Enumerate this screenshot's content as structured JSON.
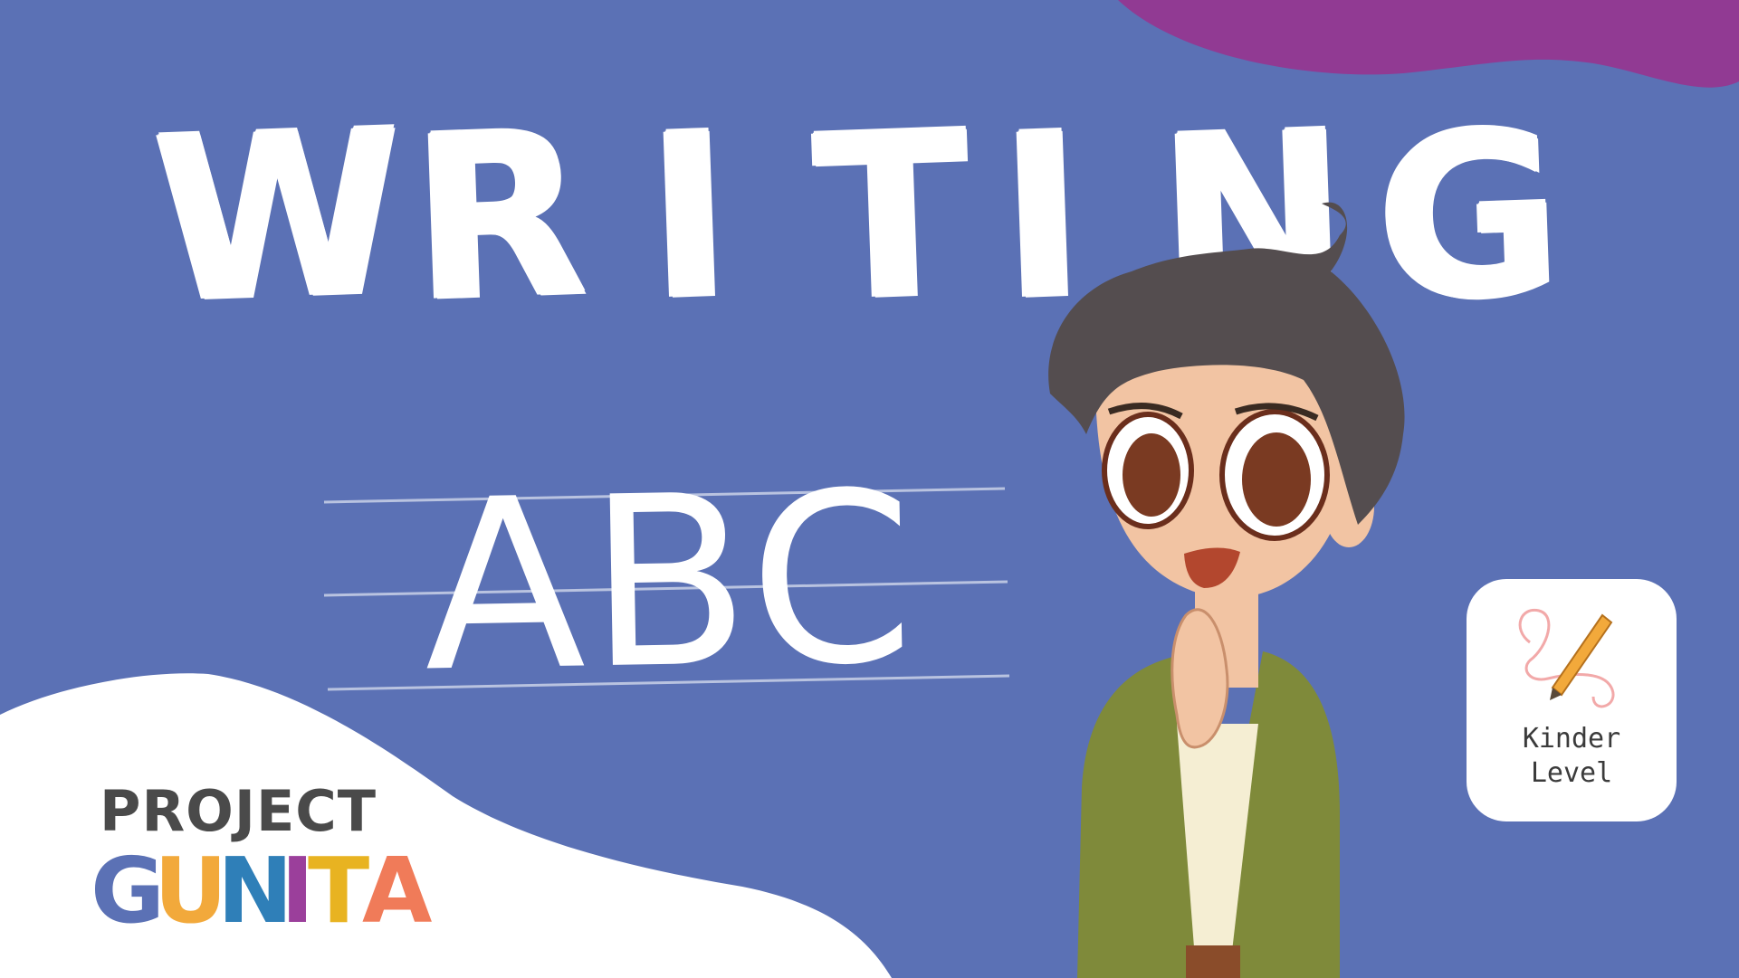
{
  "title": {
    "letters": [
      "W",
      "R",
      "I",
      "T",
      "I",
      "N",
      "G"
    ]
  },
  "lesson": {
    "letters": "ABC"
  },
  "badge": {
    "icon": "pencil-scribble-icon",
    "label_line1": "Kinder",
    "label_line2": "Level"
  },
  "logo": {
    "line1": "PROJECT",
    "line2_letters": [
      "G",
      "U",
      "N",
      "I",
      "T",
      "A"
    ],
    "line2_colors": [
      "#5b71b5",
      "#f2a93b",
      "#2f7fb8",
      "#9b3f9b",
      "#e8b321",
      "#f07b59"
    ]
  },
  "colors": {
    "background": "#5b71b5",
    "accent_purple": "#913a93",
    "white": "#ffffff"
  }
}
